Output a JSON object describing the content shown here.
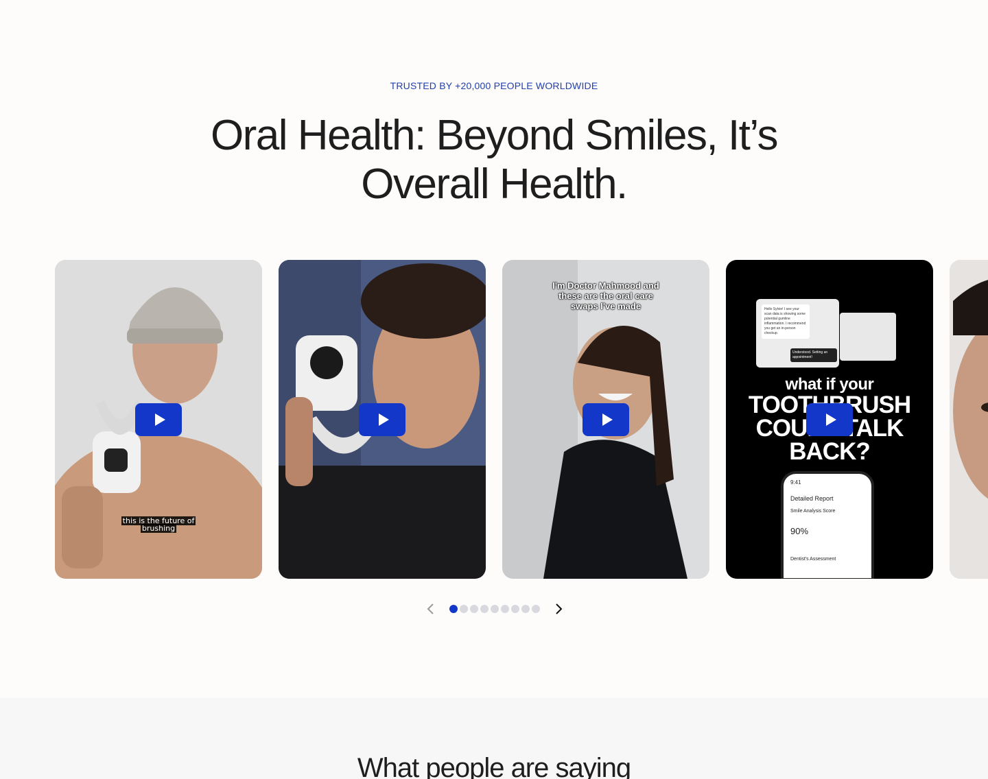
{
  "hero": {
    "eyebrow": "TRUSTED BY +20,000 PEOPLE WORLDWIDE",
    "headline_line1": "Oral Health: Beyond Smiles, It’s",
    "headline_line2": "Overall Health."
  },
  "videos": [
    {
      "caption_line1": "this is the future of",
      "caption_line2": "brushing"
    },
    {},
    {
      "overlay_line1": "I'm Doctor Mahmood and",
      "overlay_line2": "these are the oral care",
      "overlay_line3": "swaps I've made"
    },
    {
      "kicker": "what if your",
      "big_line1": "TOOTHBRUSH",
      "big_line2": "COULD TALK",
      "big_line3": "BACK?",
      "chat_message": "Hello Sylvie! I see your scan data is showing some potential gumline inflammation. I recommend you get an in-person checkup.",
      "chat_reply": "Understood. Setting an appointment!",
      "phone_time": "9:41",
      "phone_title": "Detailed Report",
      "phone_subtitle": "Smile Analysis Score",
      "phone_score": "90%",
      "phone_footer": "Dentist's Assessment"
    },
    {}
  ],
  "pager": {
    "count": 9,
    "active_index": 0
  },
  "section2": {
    "title": "What people are saying"
  },
  "colors": {
    "accent": "#1337c9",
    "eyebrow": "#1f3fb0",
    "background": "#fdfcfb"
  }
}
